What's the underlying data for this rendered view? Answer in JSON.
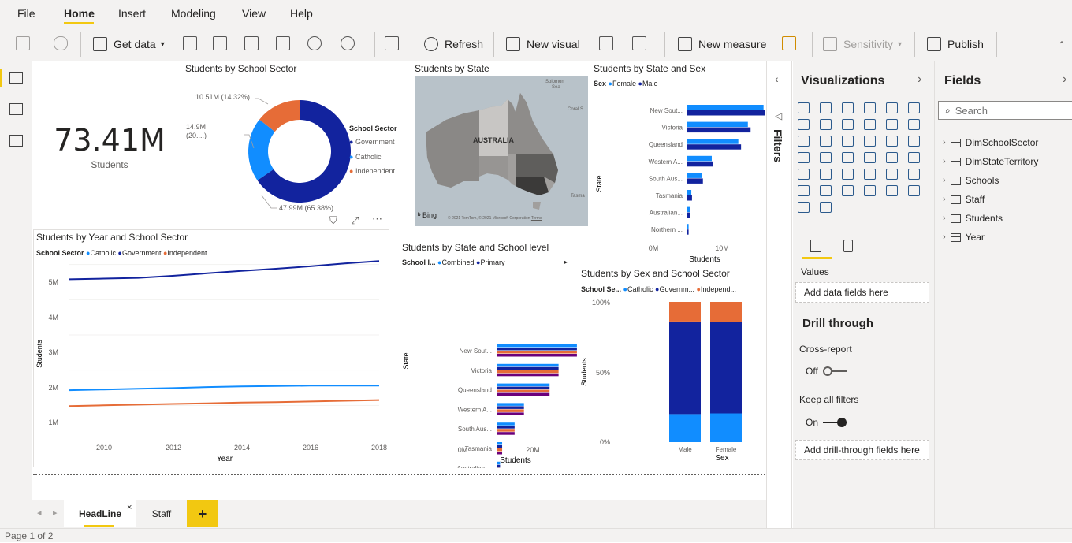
{
  "menu": {
    "items": [
      "File",
      "Home",
      "Insert",
      "Modeling",
      "View",
      "Help"
    ]
  },
  "ribbon": {
    "get_data": "Get data",
    "refresh": "Refresh",
    "new_visual": "New visual",
    "new_measure": "New measure",
    "sensitivity": "Sensitivity",
    "publish": "Publish"
  },
  "card": {
    "value": "73.41M",
    "label": "Students"
  },
  "donut": {
    "title": "Students by School Sector",
    "legend_title": "School Sector",
    "labels": {
      "independent": "10.51M (14.32%)",
      "catholic_1": "14.9M",
      "catholic_2": "(20....)",
      "government": "47.99M (65.38%)"
    },
    "chart_data": {
      "type": "pie",
      "categories": [
        "Government",
        "Catholic",
        "Independent"
      ],
      "values": [
        47.99,
        14.9,
        10.51
      ],
      "colors": [
        "#12239e",
        "#118dff",
        "#e66c37"
      ]
    }
  },
  "map": {
    "title": "Students by State",
    "country_label": "AUSTRALIA",
    "place_solomon": "Solomon",
    "place_sea": "Sea",
    "place_coral": "Coral S",
    "place_tasma": "Tasma",
    "bing": "Bing",
    "copyright": "© 2021 TomTom, © 2021 Microsoft Corporation",
    "terms": "Terms"
  },
  "state_sex": {
    "title": "Students by State and Sex",
    "legend_title": "Sex",
    "ylabel": "State",
    "xlabel": "Students",
    "xticks": [
      "0M",
      "10M"
    ],
    "chart_data": {
      "type": "bar",
      "categories": [
        "New Sout...",
        "Victoria",
        "Queensland",
        "Western A...",
        "South Aus...",
        "Tasmania",
        "Australian...",
        "Northern ..."
      ],
      "series": [
        {
          "name": "Female",
          "values": [
            11.3,
            9.0,
            7.6,
            3.7,
            2.3,
            0.7,
            0.5,
            0.3
          ]
        },
        {
          "name": "Male",
          "values": [
            11.9,
            9.4,
            8.0,
            3.9,
            2.4,
            0.8,
            0.5,
            0.3
          ]
        }
      ],
      "xlim": [
        0,
        14
      ],
      "colors": [
        "#118dff",
        "#12239e"
      ]
    }
  },
  "year_sector": {
    "title": "Students by Year and School Sector",
    "legend_title": "School Sector",
    "xlabel": "Year",
    "ylabel": "Students",
    "yticks": [
      "5M",
      "4M",
      "3M",
      "2M",
      "1M"
    ],
    "xticks": [
      "2010",
      "2012",
      "2014",
      "2016",
      "2018"
    ],
    "chart_data": {
      "type": "line",
      "x": [
        2009,
        2010,
        2011,
        2012,
        2013,
        2014,
        2015,
        2016,
        2017,
        2018
      ],
      "series": [
        {
          "name": "Catholic",
          "values": [
            1.43,
            1.45,
            1.47,
            1.49,
            1.52,
            1.54,
            1.55,
            1.56,
            1.56,
            1.56
          ]
        },
        {
          "name": "Government",
          "values": [
            4.58,
            4.6,
            4.62,
            4.68,
            4.75,
            4.82,
            4.88,
            4.95,
            5.03,
            5.1
          ]
        },
        {
          "name": "Independent",
          "values": [
            0.98,
            1.0,
            1.02,
            1.04,
            1.06,
            1.08,
            1.09,
            1.11,
            1.13,
            1.15
          ]
        }
      ],
      "ylim": [
        0,
        5.5
      ],
      "colors": [
        "#118dff",
        "#12239e",
        "#e66c37"
      ]
    }
  },
  "state_level": {
    "title": "Students by State and School level",
    "legend_title": "School l...",
    "ylabel": "State",
    "xlabel": "Students",
    "xticks": [
      "0M",
      "20M"
    ],
    "chart_data": {
      "type": "bar",
      "categories": [
        "New Sout...",
        "Victoria",
        "Queensland",
        "Western A...",
        "South Aus...",
        "Tasmania",
        "Australian ...",
        "Northern ..."
      ],
      "series": [
        {
          "name": "Combined",
          "values": [
            23.2,
            17.9,
            15.3,
            7.9,
            5.2,
            1.6,
            1.0,
            0.8
          ]
        },
        {
          "name": "Primary",
          "values": [
            23.2,
            17.9,
            15.3,
            7.9,
            5.2,
            1.6,
            1.0,
            0.8
          ]
        },
        {
          "name": "",
          "values": [
            23.2,
            17.9,
            15.3,
            7.9,
            5.2,
            1.6,
            1.0,
            0.8
          ]
        },
        {
          "name": "",
          "values": [
            23.2,
            17.9,
            15.3,
            7.9,
            5.2,
            1.6,
            1.0,
            0.8
          ]
        }
      ],
      "xlim": [
        0,
        28
      ],
      "colors": [
        "#118dff",
        "#12239e",
        "#e66c37",
        "#6b007b"
      ]
    }
  },
  "sex_sector": {
    "title": "Students by Sex and School Sector",
    "legend_title": "School Se...",
    "legend_items": [
      "Catholic",
      "Governm...",
      "Independ..."
    ],
    "xlabel": "Sex",
    "ylabel": "Students",
    "yticks": [
      "100%",
      "50%",
      "0%"
    ],
    "chart_data": {
      "type": "bar",
      "categories": [
        "Male",
        "Female"
      ],
      "series": [
        {
          "name": "Catholic",
          "values": [
            20,
            20.5
          ]
        },
        {
          "name": "Government",
          "values": [
            66,
            65
          ]
        },
        {
          "name": "Independent",
          "values": [
            14,
            14.5
          ]
        }
      ],
      "ylim": [
        0,
        100
      ],
      "colors": [
        "#118dff",
        "#12239e",
        "#e66c37"
      ]
    }
  },
  "tabs": {
    "headline": "HeadLine",
    "staff": "Staff",
    "close": "×",
    "add": "+"
  },
  "status": {
    "page": "Page 1 of 2"
  },
  "filters": {
    "label": "Filters"
  },
  "viz": {
    "title": "Visualizations",
    "values": "Values",
    "add_data": "Add data fields here",
    "drill": "Drill through",
    "cross": "Cross-report",
    "off": "Off",
    "keep": "Keep all filters",
    "on": "On",
    "add_drill": "Add drill-through fields here"
  },
  "fields": {
    "title": "Fields",
    "search_placeholder": "Search",
    "tables": [
      "DimSchoolSector",
      "DimStateTerritory",
      "Schools",
      "Staff",
      "Students",
      "Year"
    ]
  }
}
